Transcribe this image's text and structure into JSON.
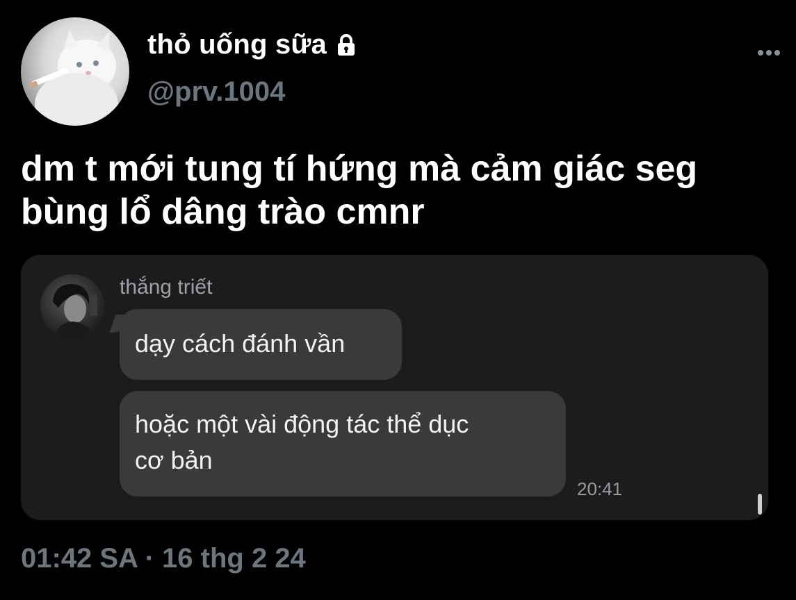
{
  "author": {
    "display_name": "thỏ uống sữa",
    "handle": "@prv.1004",
    "protected": true,
    "avatar_icon": "cat-avatar",
    "lock_icon": "lock-icon"
  },
  "menu": {
    "more_icon": "more-horizontal-icon"
  },
  "tweet": {
    "text": "dm t mới tung tí hứng mà cảm giác seg\nbùng lổ dâng trào cmnr",
    "timestamp": "01:42 SA · 16 thg 2 24"
  },
  "media": {
    "sender_name": "thắng triết",
    "sender_avatar_icon": "person-avatar",
    "messages": [
      {
        "text": "dạy cách đánh vần"
      },
      {
        "text": "hoặc một vài động tác thể dục\ncơ bản"
      }
    ],
    "time": "20:41"
  },
  "colors": {
    "background": "#000000",
    "primary_text": "#ffffff",
    "secondary_text": "#6e767d",
    "media_background": "#1c1c1e",
    "bubble_background": "#3a3a3c"
  }
}
